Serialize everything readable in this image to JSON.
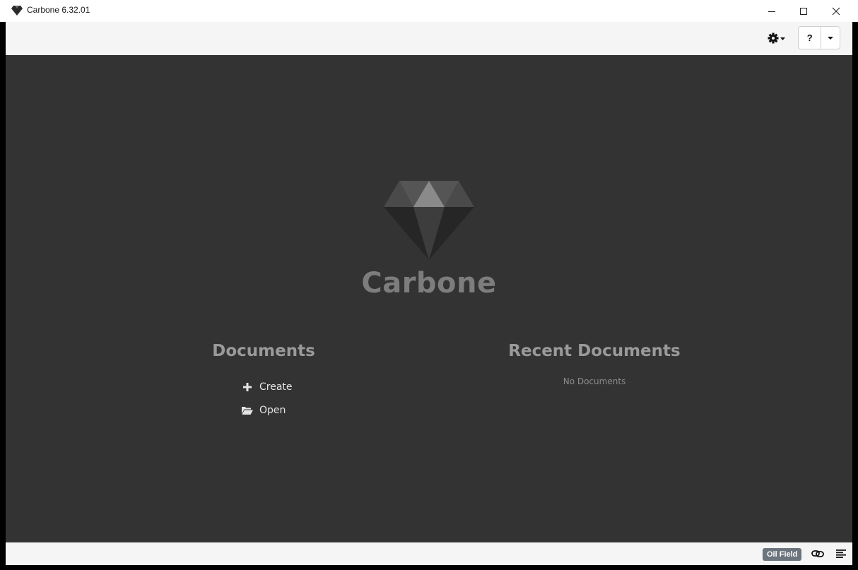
{
  "window": {
    "title": "Carbone 6.32.01",
    "icon": "diamond-icon",
    "controls": [
      "minimize-icon",
      "maximize-icon",
      "close-icon"
    ]
  },
  "toolbar": {
    "settings_icon": "gear-icon",
    "help_label": "?",
    "help_menu_icon": "caret-down-icon"
  },
  "main": {
    "brand": "Carbone",
    "logo_icon": "diamond-logo",
    "documents": {
      "title": "Documents",
      "actions": [
        {
          "label": "Create",
          "icon": "plus-icon"
        },
        {
          "label": "Open",
          "icon": "folder-open-icon"
        }
      ]
    },
    "recent": {
      "title": "Recent Documents",
      "empty_text": "No Documents"
    }
  },
  "statusbar": {
    "badge": "Oil Field",
    "icons": [
      "link-icon",
      "align-left-icon"
    ]
  },
  "colors": {
    "main_background": "#333333",
    "toolbar_background": "#f5f5f5",
    "badge_background": "#6c757d"
  }
}
